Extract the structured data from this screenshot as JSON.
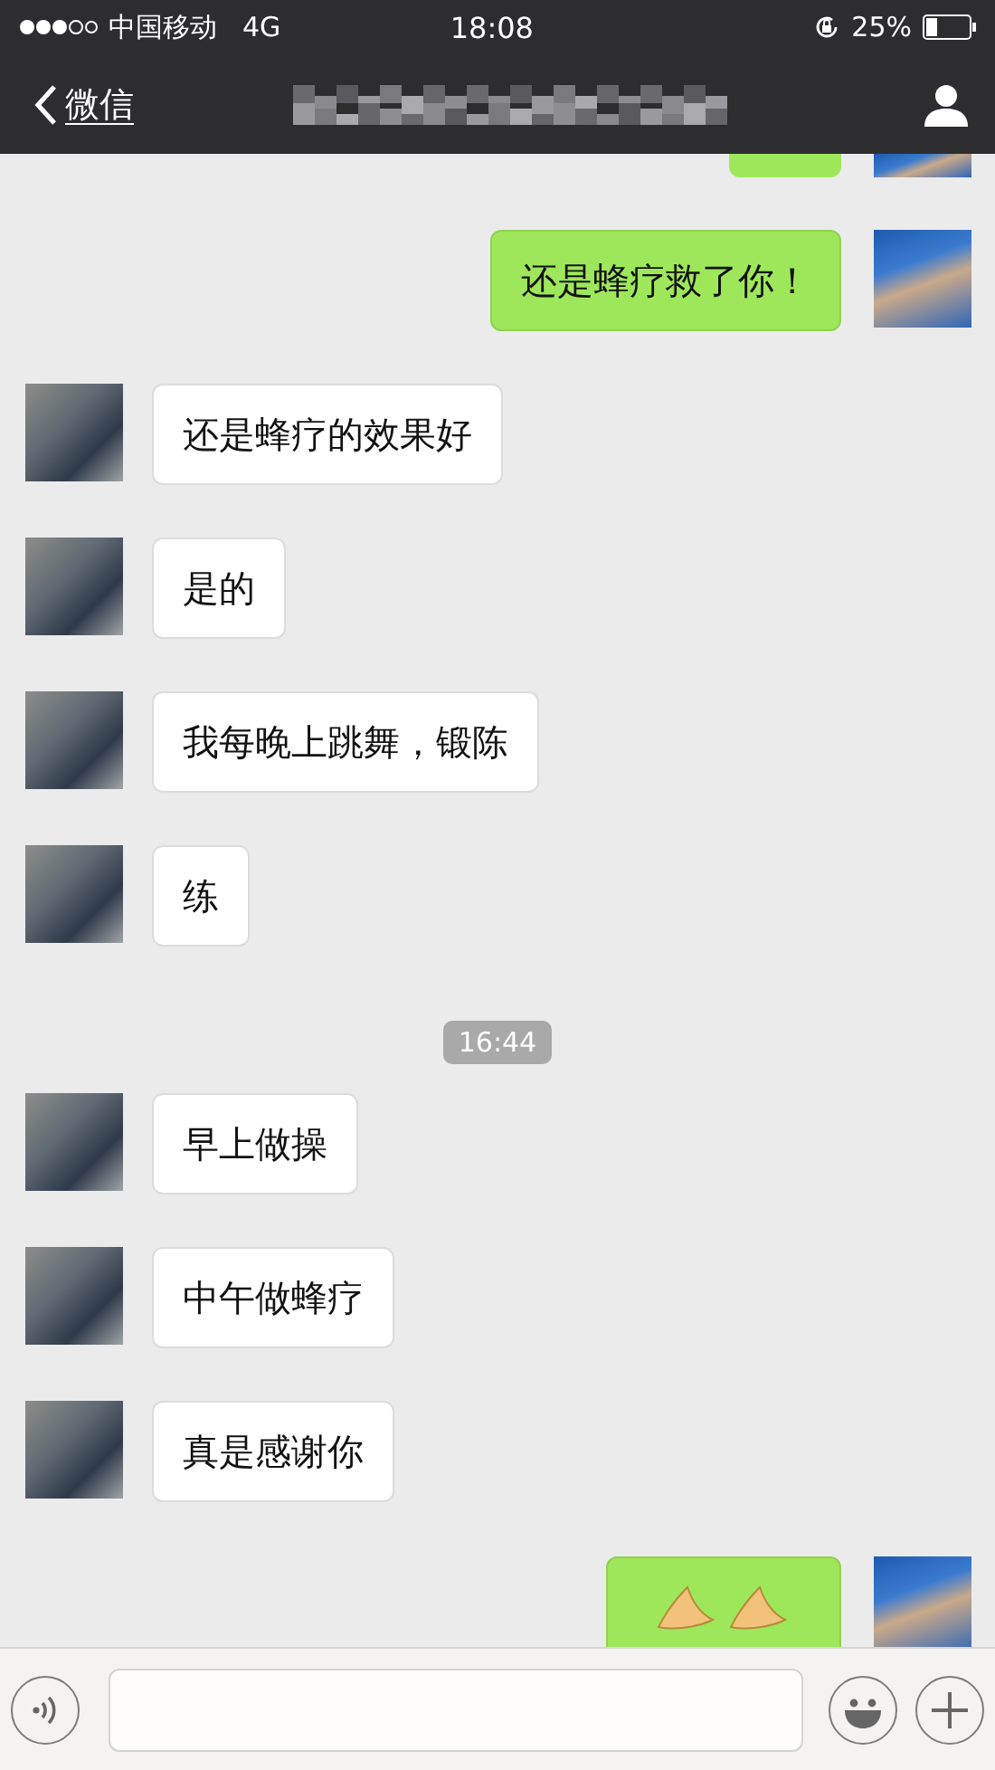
{
  "status_bar": {
    "carrier": "中国移动",
    "network": "4G",
    "time": "18:08",
    "battery": "25%"
  },
  "nav_bar": {
    "back_label": "微信"
  },
  "messages": [
    {
      "kind": "partial",
      "outgoing": true
    },
    {
      "kind": "text",
      "outgoing": true,
      "text": "还是蜂疗救了你！"
    },
    {
      "kind": "text",
      "outgoing": false,
      "text": "还是蜂疗的效果好"
    },
    {
      "kind": "text",
      "outgoing": false,
      "text": "是的"
    },
    {
      "kind": "text",
      "outgoing": false,
      "text": "我每晚上跳舞，锻陈"
    },
    {
      "kind": "text",
      "outgoing": false,
      "text": "练"
    },
    {
      "kind": "time",
      "text": "16:44"
    },
    {
      "kind": "text",
      "outgoing": false,
      "text": "早上做操"
    },
    {
      "kind": "text",
      "outgoing": false,
      "text": "中午做蜂疗"
    },
    {
      "kind": "text",
      "outgoing": false,
      "text": "真是感谢你"
    },
    {
      "kind": "sticker",
      "outgoing": true
    }
  ]
}
